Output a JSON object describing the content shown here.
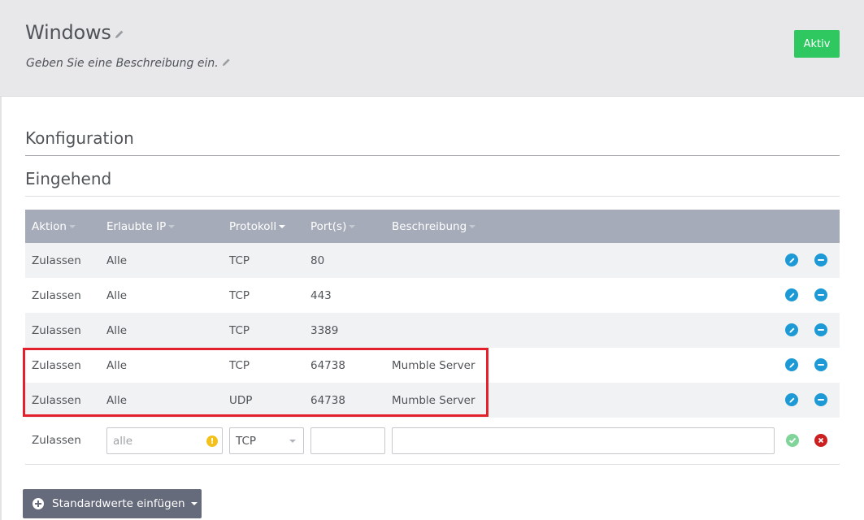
{
  "header": {
    "title": "Windows",
    "description": "Geben Sie eine Beschreibung ein.",
    "status_label": "Aktiv",
    "status_color": "#2fc860"
  },
  "sections": {
    "config_title": "Konfiguration",
    "incoming_title": "Eingehend"
  },
  "table": {
    "columns": [
      {
        "label": "Aktion",
        "sort_active": false
      },
      {
        "label": "Erlaubte IP",
        "sort_active": false
      },
      {
        "label": "Protokoll",
        "sort_active": true
      },
      {
        "label": "Port(s)",
        "sort_active": false
      },
      {
        "label": "Beschreibung",
        "sort_active": false
      }
    ],
    "rows": [
      {
        "action": "Zulassen",
        "ip": "Alle",
        "protocol": "TCP",
        "ports": "80",
        "description": ""
      },
      {
        "action": "Zulassen",
        "ip": "Alle",
        "protocol": "TCP",
        "ports": "443",
        "description": ""
      },
      {
        "action": "Zulassen",
        "ip": "Alle",
        "protocol": "TCP",
        "ports": "3389",
        "description": ""
      },
      {
        "action": "Zulassen",
        "ip": "Alle",
        "protocol": "TCP",
        "ports": "64738",
        "description": "Mumble Server"
      },
      {
        "action": "Zulassen",
        "ip": "Alle",
        "protocol": "UDP",
        "ports": "64738",
        "description": "Mumble Server"
      }
    ],
    "highlighted_rows": [
      3,
      4
    ],
    "row_icons": {
      "edit": "pencil-icon",
      "remove": "minus-circle-icon"
    }
  },
  "new_row": {
    "action": "Zulassen",
    "ip_placeholder": "alle",
    "ip_value": "",
    "ip_warning_icon": "exclamation-icon",
    "protocol_selected": "TCP",
    "ports_value": "",
    "description_value": "",
    "confirm_icon": "check-circle-icon",
    "cancel_icon": "x-circle-icon"
  },
  "footer": {
    "defaults_button_label": "Standardwerte einfügen"
  }
}
